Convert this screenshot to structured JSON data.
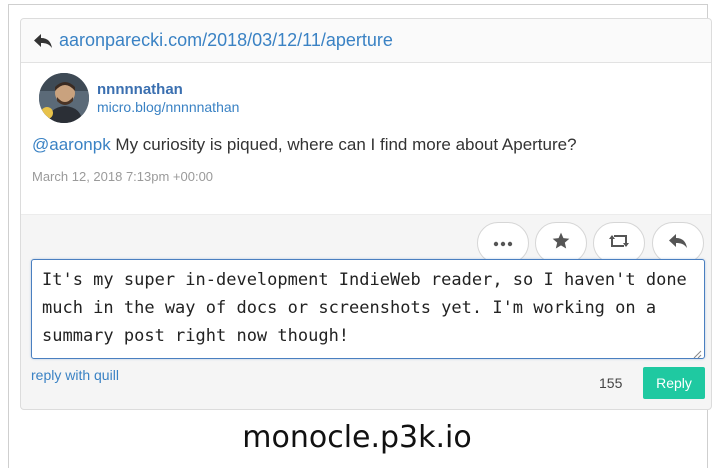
{
  "reply_context": {
    "url": "aaronparecki.com/2018/03/12/11/aperture",
    "icon": "reply-arrow-icon"
  },
  "entry": {
    "author_name": "nnnnnathan",
    "author_url": "micro.blog/nnnnnathan",
    "mention": "@aaronpk",
    "content_text": " My curiosity is piqued, where can I find more about Aperture?",
    "published": "March 12, 2018 7:13pm +00:00"
  },
  "actions": [
    {
      "name": "more",
      "icon": "ellipsis-icon"
    },
    {
      "name": "like",
      "icon": "star-icon"
    },
    {
      "name": "repost",
      "icon": "repost-icon"
    },
    {
      "name": "reply",
      "icon": "reply-icon"
    }
  ],
  "reply_form": {
    "text": "It's my super in-development IndieWeb reader, so I haven't done much in the way of docs or screenshots yet. I'm working on a summary post right now though!",
    "quill_link": "reply with quill",
    "char_count": "155",
    "button_label": "Reply"
  },
  "caption": "monocle.p3k.io",
  "colors": {
    "link": "#3a82c4",
    "reply_button": "#1fc9a1",
    "textarea_border": "#4a7fc0"
  }
}
